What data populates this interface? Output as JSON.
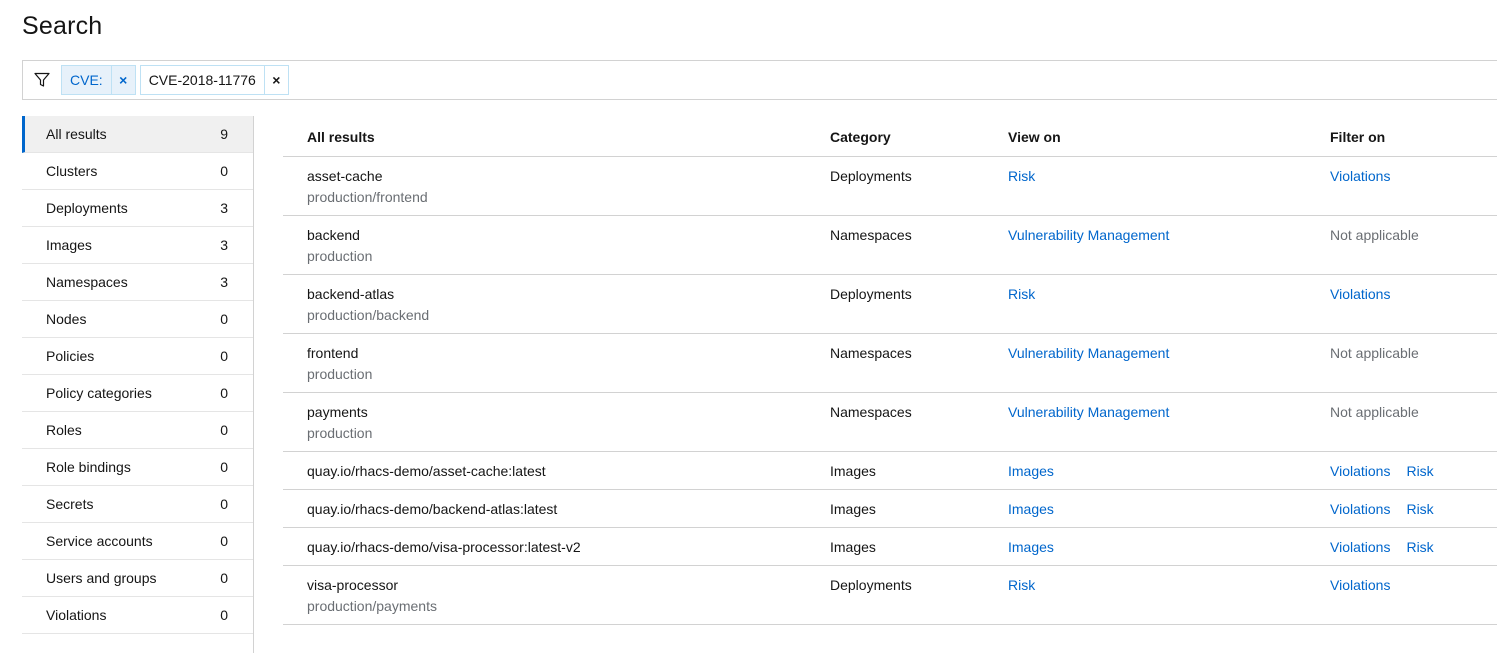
{
  "page": {
    "title": "Search"
  },
  "search": {
    "chips": [
      {
        "label": "CVE:",
        "remove": "×"
      },
      {
        "label": "CVE-2018-11776",
        "remove": "×"
      }
    ]
  },
  "sidebar": {
    "items": [
      {
        "label": "All results",
        "count": "9"
      },
      {
        "label": "Clusters",
        "count": "0"
      },
      {
        "label": "Deployments",
        "count": "3"
      },
      {
        "label": "Images",
        "count": "3"
      },
      {
        "label": "Namespaces",
        "count": "3"
      },
      {
        "label": "Nodes",
        "count": "0"
      },
      {
        "label": "Policies",
        "count": "0"
      },
      {
        "label": "Policy categories",
        "count": "0"
      },
      {
        "label": "Roles",
        "count": "0"
      },
      {
        "label": "Role bindings",
        "count": "0"
      },
      {
        "label": "Secrets",
        "count": "0"
      },
      {
        "label": "Service accounts",
        "count": "0"
      },
      {
        "label": "Users and groups",
        "count": "0"
      },
      {
        "label": "Violations",
        "count": "0"
      }
    ]
  },
  "table": {
    "headers": {
      "name": "All results",
      "category": "Category",
      "view_on": "View on",
      "filter_on": "Filter on"
    },
    "rows": [
      {
        "name": "asset-cache",
        "sub": "production/frontend",
        "category": "Deployments",
        "view": "Risk",
        "filter1": "Violations",
        "filter2": ""
      },
      {
        "name": "backend",
        "sub": "production",
        "category": "Namespaces",
        "view": "Vulnerability Management",
        "filter_na": "Not applicable"
      },
      {
        "name": "backend-atlas",
        "sub": "production/backend",
        "category": "Deployments",
        "view": "Risk",
        "filter1": "Violations",
        "filter2": ""
      },
      {
        "name": "frontend",
        "sub": "production",
        "category": "Namespaces",
        "view": "Vulnerability Management",
        "filter_na": "Not applicable"
      },
      {
        "name": "payments",
        "sub": "production",
        "category": "Namespaces",
        "view": "Vulnerability Management",
        "filter_na": "Not applicable"
      },
      {
        "name": "quay.io/rhacs-demo/asset-cache:latest",
        "sub": "",
        "category": "Images",
        "view": "Images",
        "filter1": "Violations",
        "filter2": "Risk"
      },
      {
        "name": "quay.io/rhacs-demo/backend-atlas:latest",
        "sub": "",
        "category": "Images",
        "view": "Images",
        "filter1": "Violations",
        "filter2": "Risk"
      },
      {
        "name": "quay.io/rhacs-demo/visa-processor:latest-v2",
        "sub": "",
        "category": "Images",
        "view": "Images",
        "filter1": "Violations",
        "filter2": "Risk"
      },
      {
        "name": "visa-processor",
        "sub": "production/payments",
        "category": "Deployments",
        "view": "Risk",
        "filter1": "Violations",
        "filter2": ""
      }
    ]
  },
  "colors": {
    "link": "#0066cc",
    "active_border": "#0066cc",
    "chip_bg": "#e7f1fa"
  }
}
